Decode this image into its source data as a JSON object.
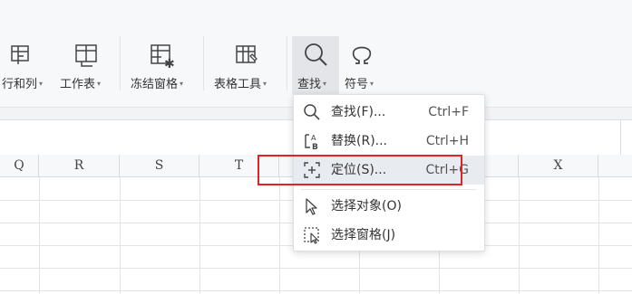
{
  "ribbon": {
    "tools": [
      {
        "label": "行和列",
        "icon": "rows-columns-icon"
      },
      {
        "label": "工作表",
        "icon": "worksheet-icon"
      },
      {
        "label": "冻结窗格",
        "icon": "freeze-panes-icon"
      },
      {
        "label": "表格工具",
        "icon": "table-tools-icon"
      },
      {
        "label": "查找",
        "icon": "find-icon"
      },
      {
        "label": "符号",
        "icon": "omega-symbol-icon"
      }
    ]
  },
  "sheet": {
    "columns": [
      "Q",
      "R",
      "S",
      "T",
      "X"
    ]
  },
  "find_menu": {
    "items": [
      {
        "label": "查找(F)...",
        "shortcut": "Ctrl+F",
        "icon": "search-icon"
      },
      {
        "label": "替换(R)...",
        "shortcut": "Ctrl+H",
        "icon": "replace-icon"
      },
      {
        "label": "定位(S)...",
        "shortcut": "Ctrl+G",
        "icon": "goto-crosshair-icon"
      },
      {
        "label": "选择对象(O)",
        "shortcut": "",
        "icon": "select-object-cursor-icon"
      },
      {
        "label": "选择窗格(J)",
        "shortcut": "",
        "icon": "selection-pane-icon"
      }
    ]
  },
  "colors": {
    "highlight_box": "#e02424",
    "hover_bg": "#e8ebef",
    "ribbon_bg": "#f7f8fa"
  }
}
